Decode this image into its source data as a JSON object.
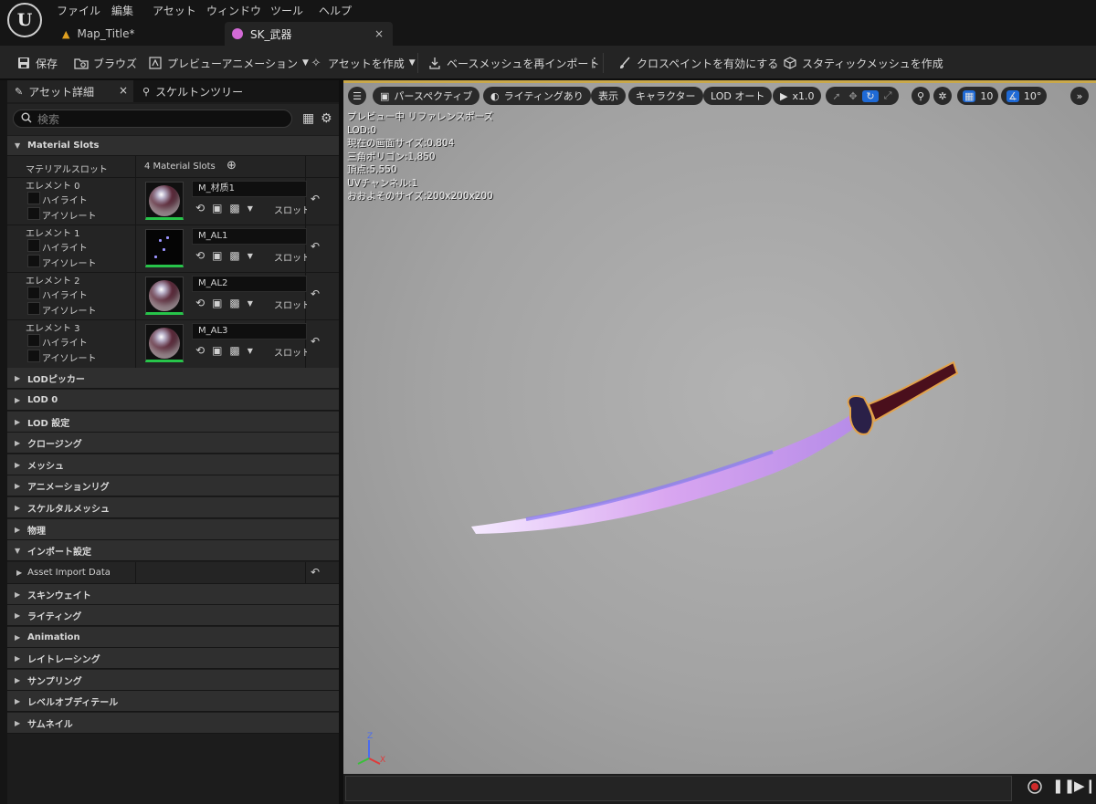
{
  "menu": {
    "logo": "U",
    "items": [
      "ファイル",
      "編集",
      "アセット",
      "ウィンドウ",
      "ツール",
      "ヘルプ"
    ]
  },
  "tabs": {
    "map": "Map_Title*",
    "sk": "SK_武器",
    "close": "×"
  },
  "toolbar": {
    "save": "保存",
    "browse": "ブラウズ",
    "preview_anim": "プレビューアニメーション",
    "create_asset": "アセットを作成",
    "reimport": "ベースメッシュを再インポート",
    "cloth_paint": "クロスペイントを有効にする",
    "make_static": "スタティックメッシュを作成"
  },
  "panel": {
    "details_tab": "アセット詳細",
    "skeleton_tab": "スケルトンツリー",
    "close": "×",
    "search_placeholder": "検索"
  },
  "material_slots": {
    "header": "Material Slots",
    "slot_label": "マテリアルスロット",
    "slot_count": "4 Material Slots",
    "highlight": "ハイライト",
    "isolate": "アイソレート",
    "slot_text": "スロット名",
    "elements": [
      {
        "label": "エレメント 0",
        "material": "M_材质1",
        "thumb": "sphere"
      },
      {
        "label": "エレメント 1",
        "material": "M_AL1",
        "thumb": "sparks"
      },
      {
        "label": "エレメント 2",
        "material": "M_AL2",
        "thumb": "sphere"
      },
      {
        "label": "エレメント 3",
        "material": "M_AL3",
        "thumb": "sphere"
      }
    ]
  },
  "categories": [
    "LODピッカー",
    "LOD 0",
    "LOD 設定",
    "クロージング",
    "メッシュ",
    "アニメーションリグ",
    "スケルタルメッシュ",
    "物理",
    "インポート設定"
  ],
  "asset_import_data": "Asset Import Data",
  "categories_after": [
    "スキンウェイト",
    "ライティング",
    "Animation",
    "レイトレーシング",
    "サンプリング",
    "レベルオブディテール",
    "サムネイル"
  ],
  "viewport": {
    "perspective": "パースペクティブ",
    "lighting": "ライティングあり",
    "show": "表示",
    "character": "キャラクター",
    "lod": "LOD オート",
    "speed": "x1.0",
    "grid": "10",
    "angle": "10°",
    "stats": [
      "プレビュー中 リファレンスポーズ",
      "LOD:0",
      "現在の画面サイズ:0.804",
      "三角ポリゴン:1,850",
      "頂点:5,550",
      "UVチャンネル:1",
      "おおよそのサイズ:200x200x200"
    ],
    "axis_z": "Z",
    "axis_x": "X"
  }
}
